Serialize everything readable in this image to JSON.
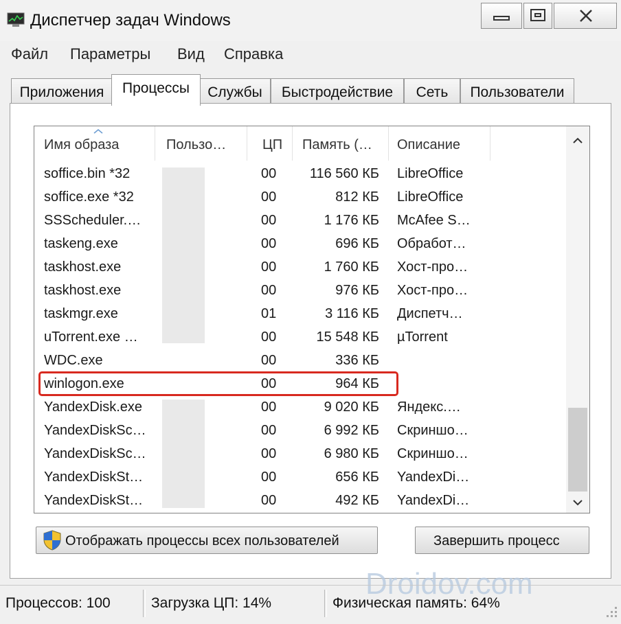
{
  "window": {
    "title": "Диспетчер задач Windows"
  },
  "menu": [
    "Файл",
    "Параметры",
    "Вид",
    "Справка"
  ],
  "tabs": [
    "Приложения",
    "Процессы",
    "Службы",
    "Быстродействие",
    "Сеть",
    "Пользователи"
  ],
  "active_tab": "Процессы",
  "columns": {
    "name": "Имя образа",
    "user": "Пользо…",
    "cpu": "ЦП",
    "memory": "Память (…",
    "description": "Описание"
  },
  "processes": [
    {
      "name": "soffice.bin *32",
      "cpu": "00",
      "memory": "116 560 КБ",
      "description": "LibreOffice"
    },
    {
      "name": "soffice.exe *32",
      "cpu": "00",
      "memory": "812 КБ",
      "description": "LibreOffice"
    },
    {
      "name": "SSScheduler.…",
      "cpu": "00",
      "memory": "1 176 КБ",
      "description": "McAfee S…"
    },
    {
      "name": "taskeng.exe",
      "cpu": "00",
      "memory": "696 КБ",
      "description": "Обработ…"
    },
    {
      "name": "taskhost.exe",
      "cpu": "00",
      "memory": "1 760 КБ",
      "description": "Хост-про…"
    },
    {
      "name": "taskhost.exe",
      "cpu": "00",
      "memory": "976 КБ",
      "description": "Хост-про…"
    },
    {
      "name": "taskmgr.exe",
      "cpu": "01",
      "memory": "3 116 КБ",
      "description": "Диспетч…"
    },
    {
      "name": "uTorrent.exe …",
      "cpu": "00",
      "memory": "15 548 КБ",
      "description": "µTorrent"
    },
    {
      "name": "WDC.exe",
      "cpu": "00",
      "memory": "336 КБ",
      "description": ""
    },
    {
      "name": "winlogon.exe",
      "cpu": "00",
      "memory": "964 КБ",
      "description": ""
    },
    {
      "name": "YandexDisk.exe",
      "cpu": "00",
      "memory": "9 020 КБ",
      "description": "Яндекс.…"
    },
    {
      "name": "YandexDiskSc…",
      "cpu": "00",
      "memory": "6 992 КБ",
      "description": "Скриншо…"
    },
    {
      "name": "YandexDiskSc…",
      "cpu": "00",
      "memory": "6 980 КБ",
      "description": "Скриншо…"
    },
    {
      "name": "YandexDiskSt…",
      "cpu": "00",
      "memory": "656 КБ",
      "description": "YandexDi…"
    },
    {
      "name": "YandexDiskSt…",
      "cpu": "00",
      "memory": "492 КБ",
      "description": "YandexDi…"
    }
  ],
  "highlighted_process": "winlogon.exe",
  "buttons": {
    "show_all": "Отображать процессы всех пользователей",
    "end_process": "Завершить процесс"
  },
  "status": {
    "processes": "Процессов: 100",
    "cpu": "Загрузка ЦП: 14%",
    "memory": "Физическая память: 64%"
  },
  "watermark": "Droidov.com",
  "colors": {
    "highlight": "#d8291f",
    "watermark": "#b9cbe0"
  },
  "icons": [
    "task-manager-app-icon",
    "minimize-icon",
    "maximize-icon",
    "close-icon",
    "sort-up-icon",
    "scroll-up-icon",
    "scroll-down-icon",
    "uac-shield-icon",
    "resize-grip-icon"
  ]
}
